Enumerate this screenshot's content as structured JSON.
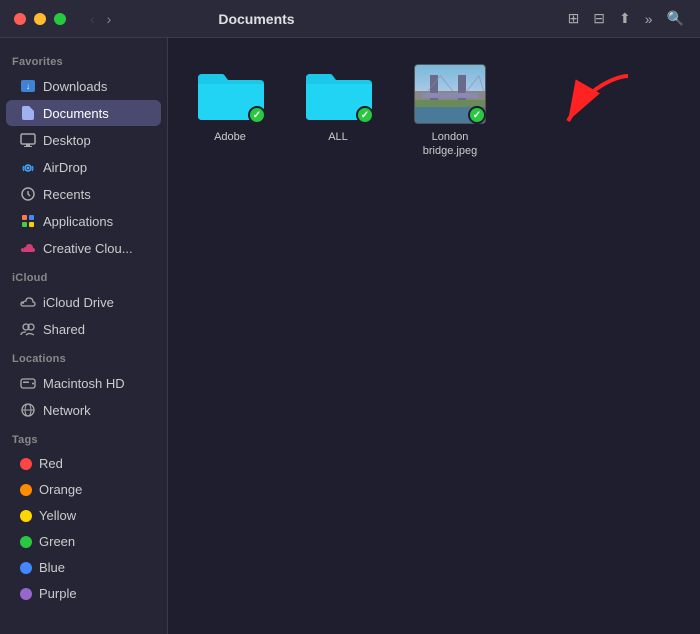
{
  "titlebar": {
    "title": "Documents",
    "back_arrow": "‹",
    "forward_arrow": "›"
  },
  "window_controls": {
    "close": "close",
    "minimize": "minimize",
    "maximize": "maximize"
  },
  "sidebar": {
    "sections": [
      {
        "label": "Favorites",
        "items": [
          {
            "id": "downloads",
            "label": "Downloads",
            "icon": "📥",
            "icon_type": "folder-down"
          },
          {
            "id": "documents",
            "label": "Documents",
            "icon": "📁",
            "icon_type": "folder",
            "active": true
          },
          {
            "id": "desktop",
            "label": "Desktop",
            "icon": "🖥",
            "icon_type": "desktop"
          },
          {
            "id": "airdrop",
            "label": "AirDrop",
            "icon": "📡",
            "icon_type": "airdrop"
          },
          {
            "id": "recents",
            "label": "Recents",
            "icon": "🕐",
            "icon_type": "recents"
          },
          {
            "id": "applications",
            "label": "Applications",
            "icon": "📦",
            "icon_type": "applications"
          },
          {
            "id": "creative-cloud",
            "label": "Creative Clou...",
            "icon": "☁",
            "icon_type": "cloud"
          }
        ]
      },
      {
        "label": "iCloud",
        "items": [
          {
            "id": "icloud-drive",
            "label": "iCloud Drive",
            "icon": "☁",
            "icon_type": "icloud"
          },
          {
            "id": "shared",
            "label": "Shared",
            "icon": "👥",
            "icon_type": "shared"
          }
        ]
      },
      {
        "label": "Locations",
        "items": [
          {
            "id": "macintosh-hd",
            "label": "Macintosh HD",
            "icon": "💾",
            "icon_type": "disk"
          },
          {
            "id": "network",
            "label": "Network",
            "icon": "🌐",
            "icon_type": "network"
          }
        ]
      },
      {
        "label": "Tags",
        "items": [
          {
            "id": "tag-red",
            "label": "Red",
            "color": "#ff4444",
            "is_tag": true
          },
          {
            "id": "tag-orange",
            "label": "Orange",
            "color": "#ff8c00",
            "is_tag": true
          },
          {
            "id": "tag-yellow",
            "label": "Yellow",
            "color": "#ffd700",
            "is_tag": true
          },
          {
            "id": "tag-green",
            "label": "Green",
            "color": "#28c840",
            "is_tag": true
          },
          {
            "id": "tag-blue",
            "label": "Blue",
            "color": "#4488ff",
            "is_tag": true
          },
          {
            "id": "tag-purple",
            "label": "Purple",
            "color": "#9966cc",
            "is_tag": true
          }
        ]
      }
    ]
  },
  "files": [
    {
      "id": "adobe",
      "type": "folder",
      "label": "Adobe",
      "checked": true
    },
    {
      "id": "all",
      "type": "folder",
      "label": "ALL",
      "checked": true
    },
    {
      "id": "london-bridge",
      "type": "image",
      "label": "London bridge.jpeg",
      "checked": true
    }
  ],
  "icons": {
    "back": "‹",
    "forward": "›",
    "grid_view": "⊞",
    "list_view": "☰",
    "share": "⎋",
    "more": "»",
    "search": "🔍",
    "checkmark": "✓"
  }
}
